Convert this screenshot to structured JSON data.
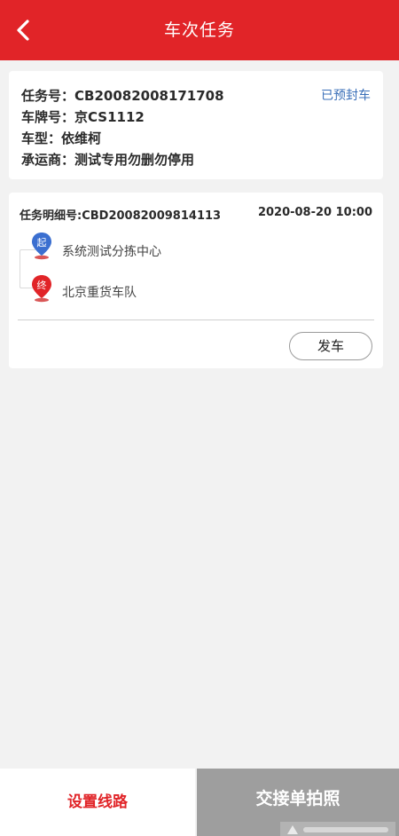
{
  "header": {
    "title": "车次任务",
    "back_icon": "chevron-left-icon",
    "bg_color": "#e12428"
  },
  "task": {
    "task_no": "任务号：CB20082008171708",
    "plate_no": "车牌号：京CS1112",
    "vehicle_type": "车型：依维柯",
    "carrier": "承运商：测试专用勿删勿停用",
    "status": "已预封车",
    "status_color": "#3a6fb8"
  },
  "detail": {
    "detail_no": "任务明细号:CBD20082009814113",
    "time": "2020-08-20 10:00",
    "start_badge": "起",
    "start_color": "#3b6fd0",
    "start_place": "系统测试分拣中心",
    "end_badge": "终",
    "end_color": "#e12428",
    "end_place": "北京重货车队",
    "depart_label": "发车"
  },
  "bottom": {
    "set_route_label": "设置线路",
    "photo_label": "交接单拍照"
  }
}
